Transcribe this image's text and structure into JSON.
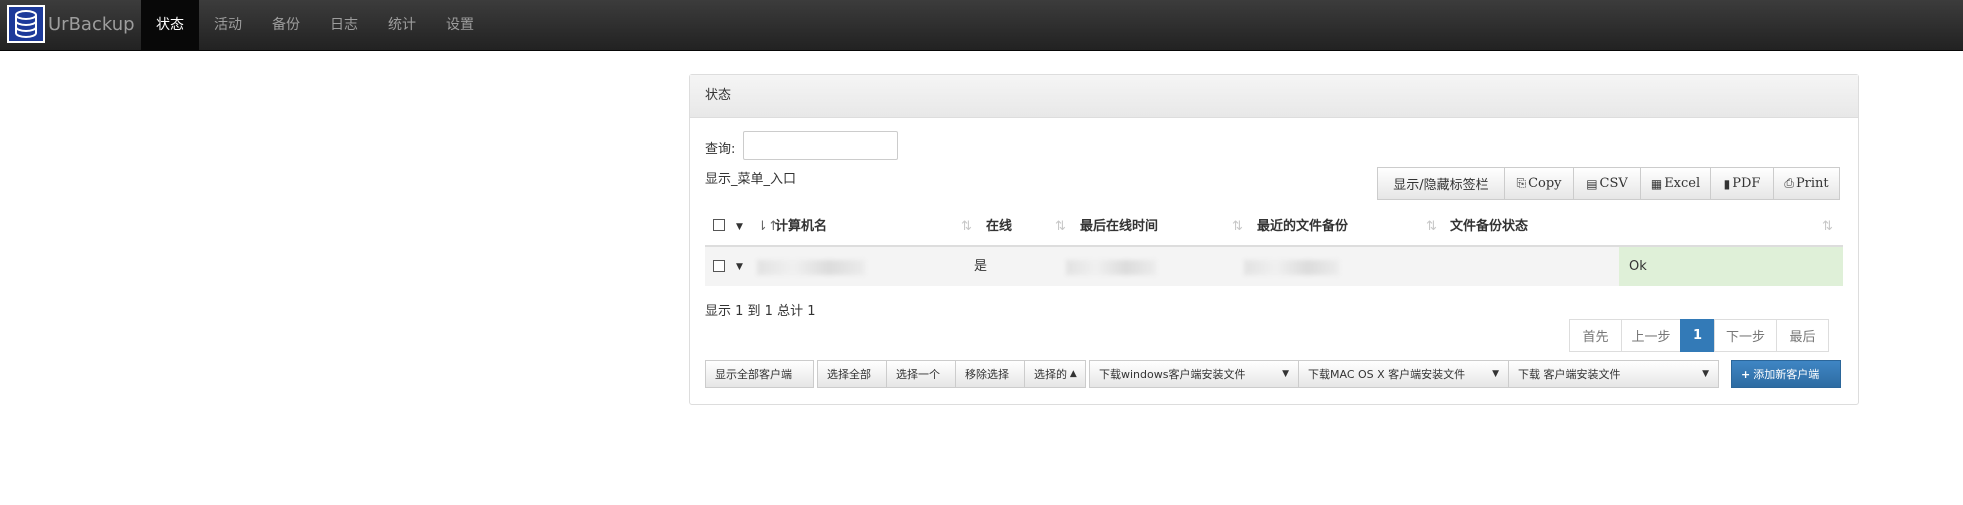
{
  "app": {
    "brand": "UrBackup"
  },
  "nav": [
    "状态",
    "活动",
    "备份",
    "日志",
    "统计",
    "设置"
  ],
  "panel": {
    "title": "状态",
    "search_label": "查询:",
    "search_value": "",
    "menu_entry": "显示_菜单_入口"
  },
  "toolbar": {
    "show_hide": "显示/隐藏标签栏",
    "copy": "Copy",
    "csv": "CSV",
    "excel": "Excel",
    "pdf": "PDF",
    "print": "Print"
  },
  "table": {
    "columns": [
      "计算机名",
      "在线",
      "最后在线时间",
      "最近的文件备份",
      "文件备份状态"
    ],
    "rows": [
      {
        "online": "是",
        "status": "Ok"
      }
    ]
  },
  "info": "显示 1 到 1 总计 1",
  "pagination": {
    "first": "首先",
    "prev": "上一步",
    "current": "1",
    "next": "下一步",
    "last": "最后"
  },
  "actions": {
    "show_all": "显示全部客户端",
    "select_all": "选择全部",
    "select_one": "选择一个",
    "remove_selection": "移除选择",
    "selected": "选择的",
    "dl_windows": "下载windows客户端安装文件",
    "dl_mac": "下载MAC OS X 客户端安装文件",
    "dl_other": "下载 客户端安装文件",
    "add_client": "添加新客户端"
  },
  "colors": {
    "primary": "#337ab7",
    "ok": "#dff0d8",
    "navbar": "#222222"
  }
}
